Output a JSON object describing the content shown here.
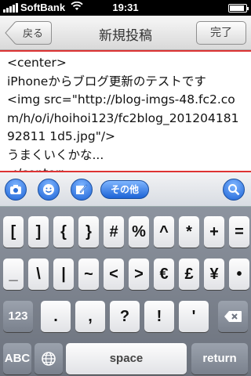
{
  "status_bar": {
    "carrier": "SoftBank",
    "time": "19:31",
    "battery_percent": 90
  },
  "nav": {
    "back_label": "戻る",
    "title": "新規投稿",
    "done_label": "完了"
  },
  "editor": {
    "lines": [
      "<center>",
      "iPhoneからブログ更新のテストです",
      "<img src=\"http://blog-imgs-48.fc2.com/h/o/i/hoihoi123/fc2blog_20120418192811 1d5.jpg\"/>",
      "うまくいくかな...",
      "</center>"
    ]
  },
  "toolbar": {
    "camera_icon": "camera-icon",
    "emoji_icon": "smiley-icon",
    "edit_icon": "pen-edit-icon",
    "other_label": "その他",
    "search_icon": "search-icon"
  },
  "keyboard": {
    "row1": [
      "[",
      "]",
      "{",
      "}",
      "#",
      "%",
      "^",
      "*",
      "+",
      "="
    ],
    "row2": [
      "_",
      "\\",
      "|",
      "~",
      "<",
      ">",
      "€",
      "£",
      "¥",
      "•"
    ],
    "row3_left": "123",
    "row3": [
      ".",
      ",",
      "?",
      "!",
      "'"
    ],
    "row4_left": "ABC",
    "space": "space",
    "return": "return"
  }
}
